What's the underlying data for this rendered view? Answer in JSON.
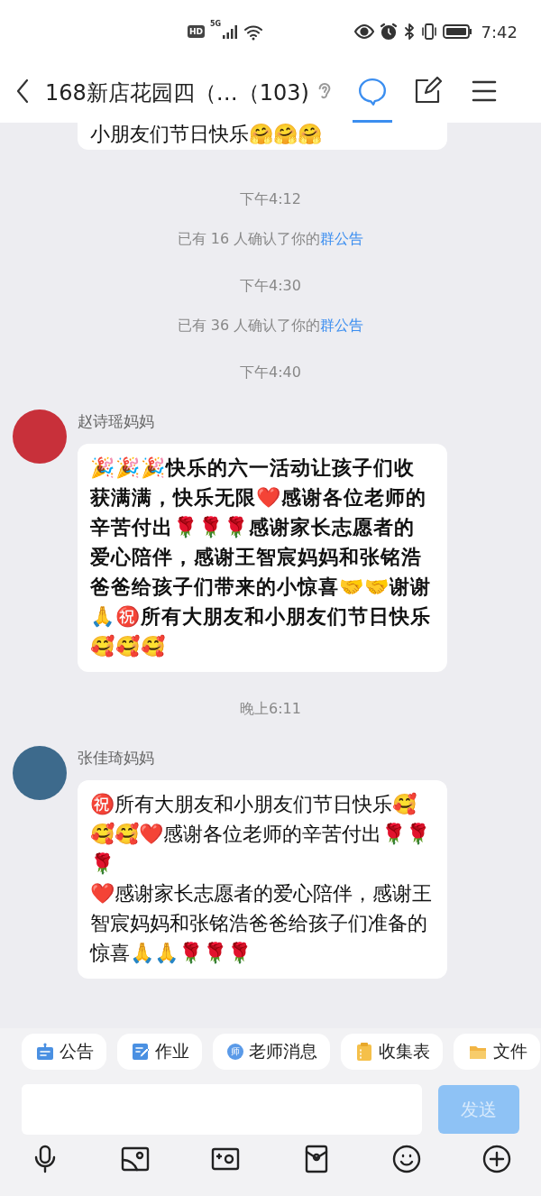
{
  "status_bar": {
    "hd": "HD",
    "network": "5G",
    "time": "7:42"
  },
  "header": {
    "title": "168新店花园四（…（103)",
    "tabs": [
      {
        "kind": "chat",
        "selected": true
      },
      {
        "kind": "edit",
        "selected": false
      }
    ]
  },
  "messages": [
    {
      "kind": "partial",
      "text": "小朋友们节日快乐🤗🤗🤗"
    },
    {
      "kind": "time",
      "text": "下午4:12"
    },
    {
      "kind": "notice",
      "text": "已有 16 人确认了你的",
      "link": "群公告"
    },
    {
      "kind": "time",
      "text": "下午4:30"
    },
    {
      "kind": "notice",
      "text": "已有 36 人确认了你的",
      "link": "群公告"
    },
    {
      "kind": "time",
      "text": "下午4:40"
    },
    {
      "kind": "handwritten-message",
      "sender": "赵诗瑶妈妈",
      "text": "🎉🎉🎉快乐的六一活动让孩子们收获满满，快乐无限❤️感谢各位老师的辛苦付出🌹🌹🌹感谢家长志愿者的爱心陪伴，感谢王智宸妈妈和张铭浩爸爸给孩子们带来的小惊喜🤝🤝谢谢🙏㊗️所有大朋友和小朋友们节日快乐🥰🥰🥰"
    },
    {
      "kind": "time",
      "text": "晚上6:11"
    },
    {
      "kind": "message",
      "sender": "张佳琦妈妈",
      "text": "㊗️所有大朋友和小朋友们节日快乐🥰🥰🥰❤️感谢各位老师的辛苦付出🌹🌹🌹\n❤️感谢家长志愿者的爱心陪伴，感谢王智宸妈妈和张铭浩爸爸给孩子们准备的惊喜🙏🙏🌹🌹🌹"
    }
  ],
  "quick_actions": [
    {
      "kind": "notice",
      "label": "公告"
    },
    {
      "kind": "homework",
      "label": "作业"
    },
    {
      "kind": "teacher",
      "label": "老师消息",
      "icon_text": "师"
    },
    {
      "kind": "form",
      "label": "收集表"
    },
    {
      "kind": "file",
      "label": "文件"
    }
  ],
  "composer": {
    "send_label": "发送",
    "send_disabled": true
  },
  "toolbar": [
    {
      "kind": "voice"
    },
    {
      "kind": "image"
    },
    {
      "kind": "camera"
    },
    {
      "kind": "red-packet"
    },
    {
      "kind": "emoji"
    },
    {
      "kind": "more"
    }
  ]
}
